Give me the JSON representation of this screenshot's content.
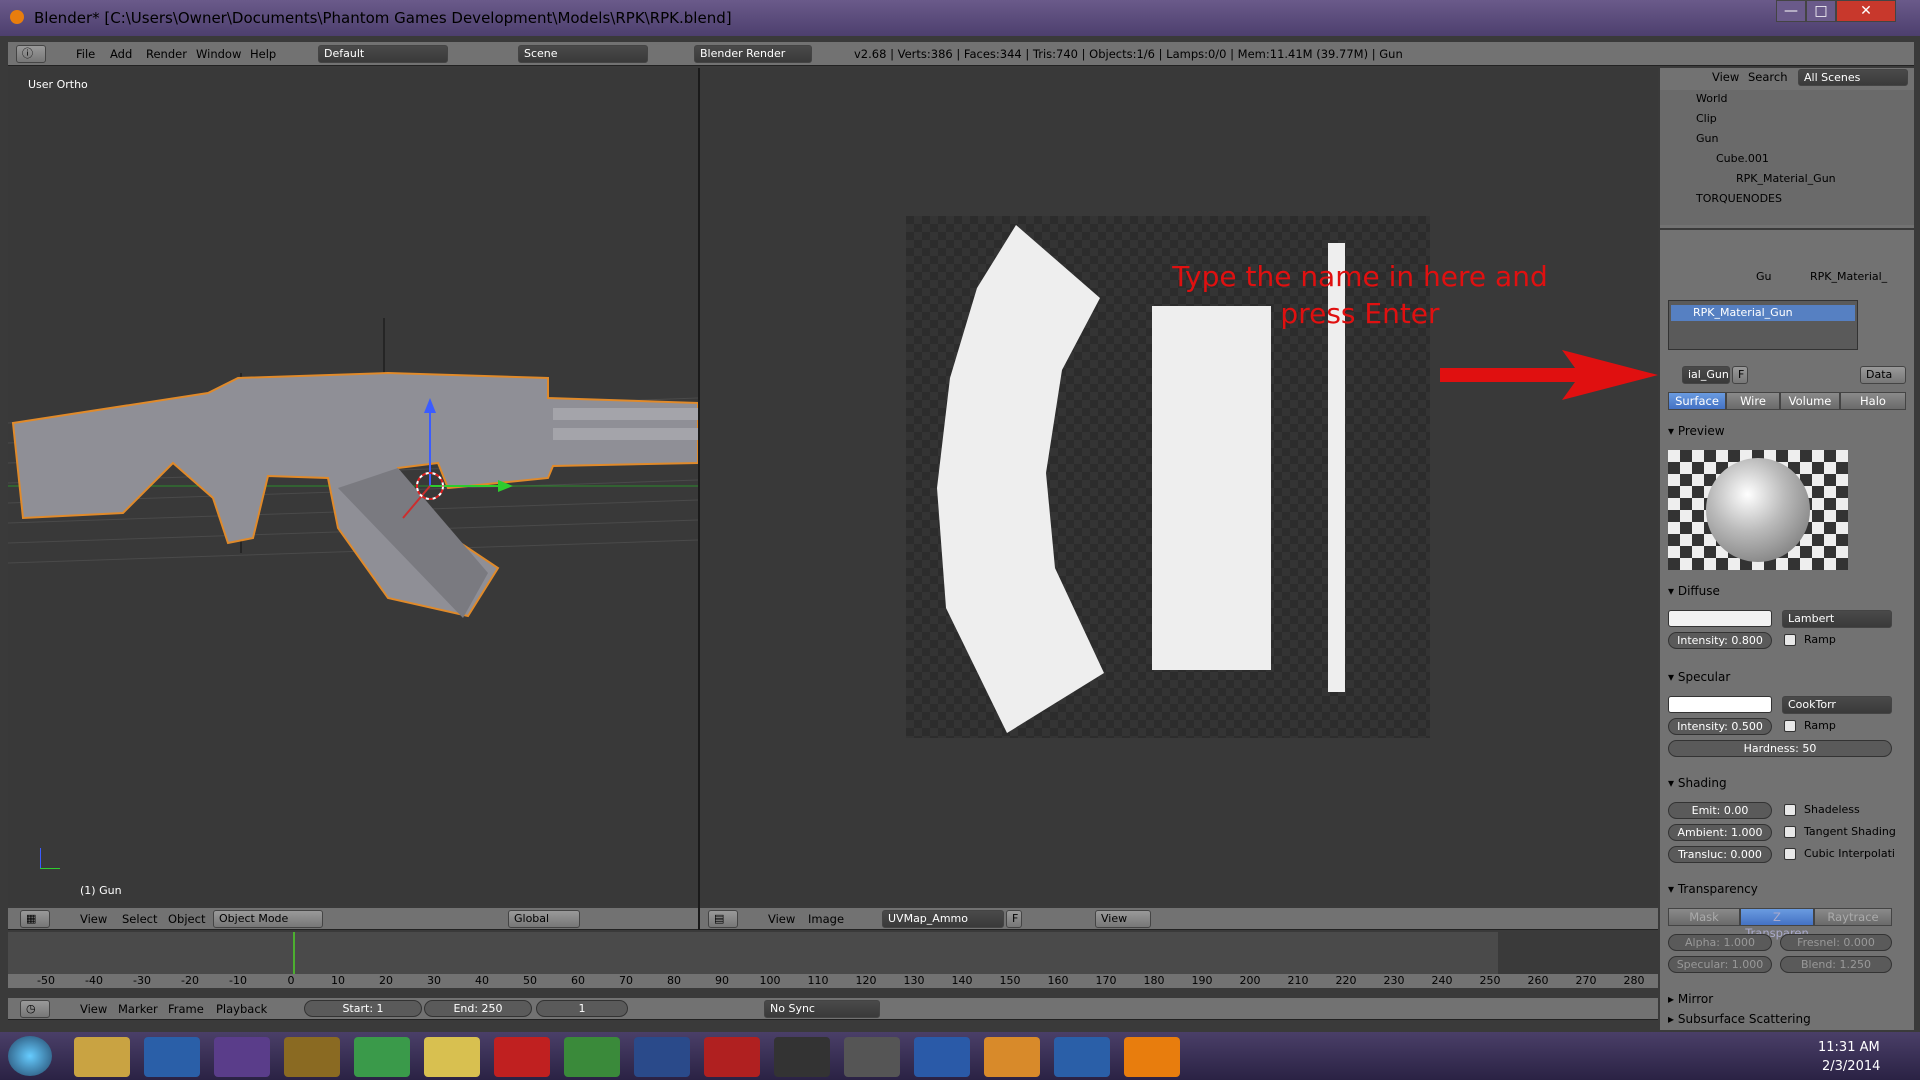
{
  "window": {
    "title": "Blender* [C:\\Users\\Owner\\Documents\\Phantom Games Development\\Models\\RPK\\RPK.blend]",
    "min": "—",
    "max": "□",
    "close": "✕"
  },
  "info_bar": {
    "menus": [
      "File",
      "Add",
      "Render",
      "Window",
      "Help"
    ],
    "layout": "Default",
    "scene": "Scene",
    "engine": "Blender Render",
    "stats": "v2.68 | Verts:386 | Faces:344 | Tris:740 | Objects:1/6 | Lamps:0/0 | Mem:11.41M (39.77M) | Gun"
  },
  "viewport": {
    "label": "User Ortho",
    "object_label": "(1) Gun",
    "header": {
      "menus": [
        "View",
        "Select",
        "Object"
      ],
      "mode": "Object Mode",
      "orientation": "Global"
    }
  },
  "uv_editor": {
    "header": {
      "menus": [
        "View",
        "Image"
      ],
      "image_name": "UVMap_Ammo",
      "fake_user": "F",
      "view": "View"
    }
  },
  "annotation": {
    "text": "Type the name in here and press Enter",
    "color": "#e01010"
  },
  "outliner": {
    "menus": [
      "View",
      "Search"
    ],
    "filter": "All Scenes",
    "items": [
      {
        "name": "World",
        "indent": 0
      },
      {
        "name": "Clip",
        "indent": 0
      },
      {
        "name": "Gun",
        "indent": 0
      },
      {
        "name": "Cube.001",
        "indent": 1
      },
      {
        "name": "RPK_Material_Gun",
        "indent": 2
      },
      {
        "name": "TORQUENODES",
        "indent": 0
      }
    ]
  },
  "properties": {
    "breadcrumb": [
      "Gu",
      "RPK_Material_"
    ],
    "slot": "RPK_Material_Gun",
    "name_field": "ial_Gun",
    "f": "F",
    "data": "Data",
    "tabs": [
      "Surface",
      "Wire",
      "Volume",
      "Halo"
    ],
    "preview": "Preview",
    "diffuse": {
      "title": "Diffuse",
      "shader": "Lambert",
      "intensity": "Intensity: 0.800",
      "ramp": "Ramp"
    },
    "specular": {
      "title": "Specular",
      "shader": "CookTorr",
      "intensity": "Intensity: 0.500",
      "ramp": "Ramp",
      "hardness": "Hardness: 50"
    },
    "shading": {
      "title": "Shading",
      "emit": "Emit: 0.00",
      "ambient": "Ambient: 1.000",
      "transluc": "Transluc: 0.000",
      "shadeless": "Shadeless",
      "tangent": "Tangent Shading",
      "cubic": "Cubic Interpolati"
    },
    "transparency": {
      "title": "Transparency",
      "modes": [
        "Mask",
        "Z Transparen",
        "Raytrace"
      ],
      "alpha": "Alpha: 1.000",
      "fresnel": "Fresnel: 0.000",
      "specular": "Specular: 1.000",
      "blend": "Blend: 1.250"
    },
    "mirror": "Mirror",
    "sss": "Subsurface Scattering"
  },
  "timeline": {
    "ticks": [
      "-50",
      "-40",
      "-30",
      "-20",
      "-10",
      "0",
      "10",
      "20",
      "30",
      "40",
      "50",
      "60",
      "70",
      "80",
      "90",
      "100",
      "110",
      "120",
      "130",
      "140",
      "150",
      "160",
      "170",
      "180",
      "190",
      "200",
      "210",
      "220",
      "230",
      "240",
      "250",
      "260",
      "270",
      "280"
    ],
    "menus": [
      "View",
      "Marker",
      "Frame",
      "Playback"
    ],
    "start": "Start: 1",
    "end": "End: 250",
    "current": "1",
    "sync": "No Sync"
  },
  "taskbar": {
    "time": "11:31 AM",
    "date": "2/3/2014",
    "apps": [
      "Explorer",
      "PSE",
      "Tor",
      "Ant",
      "Crystal",
      "Sticky",
      "FileZilla",
      "Chrome",
      "Thunderbird",
      "Adobe",
      "Steam",
      "Plane",
      "Word",
      "Media",
      "PSE",
      "Blender"
    ]
  }
}
